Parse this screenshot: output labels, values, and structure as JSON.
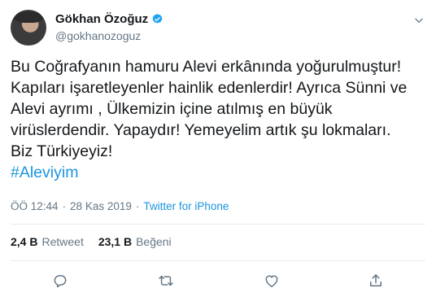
{
  "author": {
    "name": "Gökhan Özoğuz",
    "handle": "@gokhanozoguz"
  },
  "tweet": {
    "text": "Bu Coğrafyanın hamuru Alevi erkânında yoğurulmuştur!\nKapıları işaretleyenler hainlik edenlerdir! Ayrıca Sünni ve Alevi ayrımı , Ülkemizin içine atılmış en büyük virüslerdendir. Yapaydır! Yemeyelim artık şu lokmaları.\nBiz Türkiyeyiz!",
    "hashtag": "#Aleviyim"
  },
  "meta": {
    "time": "ÖÖ 12:44",
    "date": "28 Kas 2019",
    "source": "Twitter for iPhone",
    "separator": "·"
  },
  "stats": {
    "retweets_value": "2,4 B",
    "retweets_label": "Retweet",
    "likes_value": "23,1 B",
    "likes_label": "Beğeni"
  },
  "colors": {
    "link": "#1b95e0",
    "muted": "#657786",
    "text": "#14171a",
    "divider": "#e6ecf0"
  }
}
